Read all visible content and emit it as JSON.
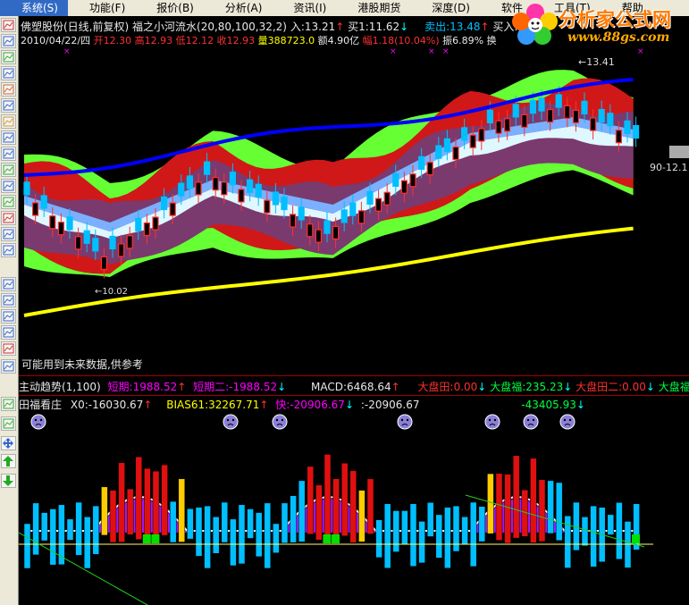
{
  "menu": {
    "items": [
      "系统(S)",
      "功能(F)",
      "报价(B)",
      "分析(A)",
      "资讯(I)",
      "港股期货",
      "深度(D)",
      "软件",
      "工具(T)",
      "帮助"
    ]
  },
  "logo": {
    "text": "分析家公式网",
    "url": "www.88gs.com"
  },
  "main_chart": {
    "title": "佛塑股份(日线,前复权)",
    "indicator": "福之小河流水(20,80,100,32,2)",
    "entry": "入:13.21",
    "buy": "买1:11.62",
    "sell_partial": "卖出:13.48",
    "buy_partial": "买入:1",
    "date": "2010/04/22/四",
    "open": "开12.30",
    "high": "高12.93",
    "low": "低12.12",
    "close": "收12.93",
    "volume": "量388723.0",
    "amount": "额4.90亿",
    "change": "幅1.18(10.04%)",
    "amplitude": "振6.89%",
    "turnover": "换",
    "high_marker": "13.41",
    "low_marker": "10.02",
    "right_label": "90-12.1",
    "warning": "可能用到未来数据,供参考"
  },
  "sub1": {
    "name": "主动趋势(1,100)",
    "short1": "短期:1988.52",
    "short2": "短期二:-1988.52",
    "macd": "MACD:6468.64",
    "dp_tian": "大盘田:0.00",
    "dp_fu": "大盘福:235.23",
    "dp_tian2": "大盘田二:0.00",
    "dp_fu2": "大盘福二"
  },
  "sub2": {
    "name": "田福看庄",
    "x0": "X0:-16030.67",
    "bias": "BIAS61:32267.71",
    "kuai": "快:-20906.67",
    "colon_val": ":-20906.67",
    "dash_val": "-43405.93"
  },
  "colors": {
    "up": "#ff3030",
    "down": "#00bfff",
    "ma_blue": "#0000ff",
    "ma_yellow": "#ffff00",
    "band_green": "#66ff33",
    "band_purple": "#7a3a6e",
    "band_red": "#d01818",
    "band_cyan": "#e0ffff"
  }
}
